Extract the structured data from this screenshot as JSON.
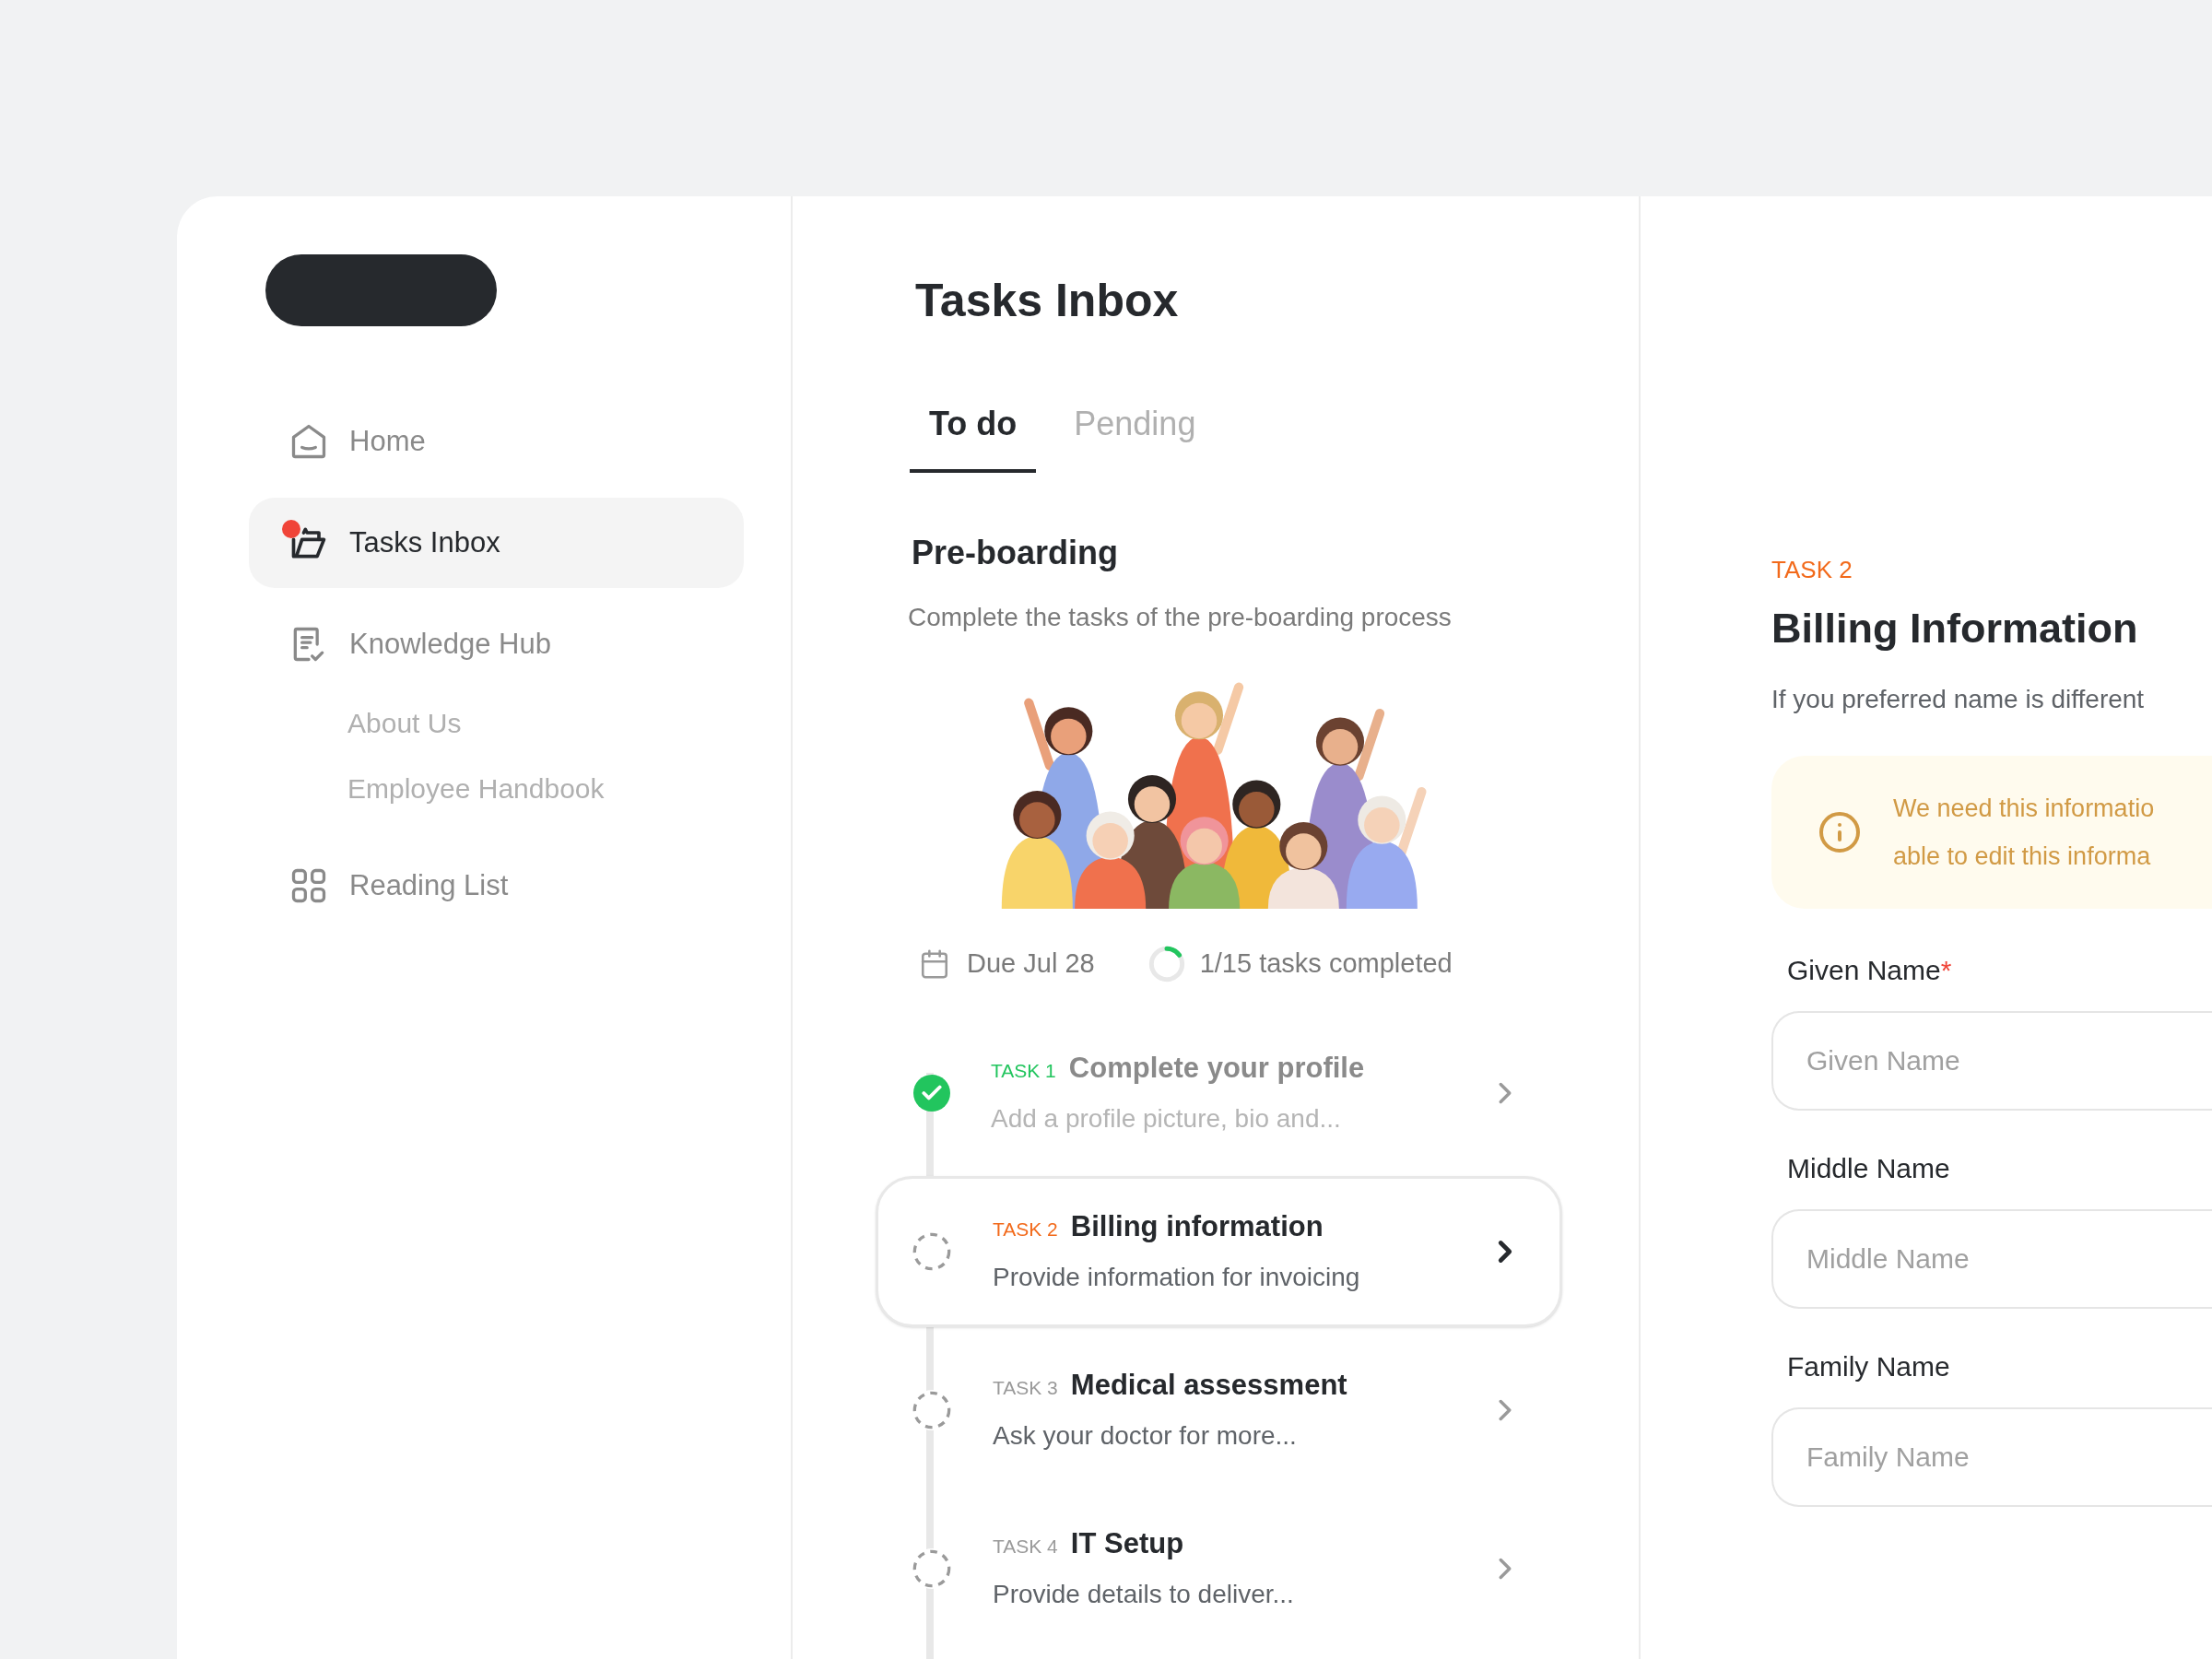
{
  "sidebar": {
    "items": [
      {
        "label": "Home",
        "selected": false,
        "notification": false
      },
      {
        "label": "Tasks Inbox",
        "selected": true,
        "notification": true
      },
      {
        "label": "Knowledge Hub",
        "selected": false,
        "notification": false,
        "children": [
          {
            "label": "About Us"
          },
          {
            "label": "Employee Handbook"
          }
        ]
      },
      {
        "label": "Reading List",
        "selected": false,
        "notification": false
      }
    ]
  },
  "main": {
    "title": "Tasks Inbox",
    "tabs": [
      {
        "label": "To do",
        "selected": true
      },
      {
        "label": "Pending",
        "selected": false
      }
    ],
    "section": {
      "title": "Pre-boarding",
      "description": "Complete the tasks of the pre-boarding process",
      "due": "Due Jul 28",
      "progress": {
        "level": 0.15,
        "text": "1/15 tasks completed"
      }
    },
    "tasks": [
      {
        "tag": "TASK 1",
        "title": "Complete your profile",
        "subtitle": "Add a profile picture, bio and...",
        "done": true,
        "selected": false
      },
      {
        "tag": "TASK 2",
        "title": "Billing information",
        "subtitle": "Provide information for invoicing",
        "done": false,
        "selected": true
      },
      {
        "tag": "TASK 3",
        "title": "Medical assessment",
        "subtitle": "Ask your doctor for more...",
        "done": false,
        "selected": false
      },
      {
        "tag": "TASK 4",
        "title": "IT Setup",
        "subtitle": "Provide details to deliver...",
        "done": false,
        "selected": false
      }
    ]
  },
  "detail": {
    "tag": "TASK 2",
    "title": "Billing Information",
    "description": "If you preferred name is different",
    "notice": [
      "We need this informatio",
      "able to edit this informa"
    ],
    "fields": [
      {
        "label": "Given Name",
        "required_mark": "*",
        "placeholder": "Given Name"
      },
      {
        "label": "Middle Name",
        "placeholder": "Middle Name"
      },
      {
        "label": "Family Name",
        "placeholder": "Family Name"
      }
    ]
  }
}
